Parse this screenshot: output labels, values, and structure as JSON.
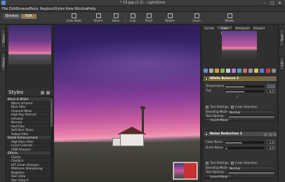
{
  "window": {
    "title": "* 19.jpg (1:2) – LightZone",
    "controls": [
      "–",
      "□",
      "✕"
    ]
  },
  "menu": [
    "File",
    "Edit",
    "Browser",
    "Tools",
    "Regions",
    "Styles",
    "View",
    "Window",
    "Help"
  ],
  "modes": {
    "browse": "Browse",
    "edit": "Edit"
  },
  "toolbar": {
    "items": [
      "Undo Redo",
      "Revert",
      "Done",
      "Crop",
      "Proof",
      "Rotate",
      "Zoom"
    ],
    "right_label": "Modes"
  },
  "left_strip": {
    "tabs": [
      "Styles",
      "History"
    ]
  },
  "styles_panel": {
    "title": "Styles",
    "rows": [
      {
        "label": "Black & White",
        "kind": "cat"
      },
      {
        "label": "Warm Infrared",
        "kind": "item"
      },
      {
        "label": "Blue Filter",
        "kind": "item"
      },
      {
        "label": "Channel Mixer",
        "kind": "item"
      },
      {
        "label": "High Key Portrait",
        "kind": "item"
      },
      {
        "label": "Infrared",
        "kind": "item"
      },
      {
        "label": "Normal",
        "kind": "item"
      },
      {
        "label": "Red Filter",
        "kind": "item"
      },
      {
        "label": "Soft Skin Tones",
        "kind": "item"
      },
      {
        "label": "Yellow Filter",
        "kind": "item"
      },
      {
        "label": "Detail Enhancement",
        "kind": "cat"
      },
      {
        "label": "High-Pass Filter",
        "kind": "item"
      },
      {
        "label": "Local Contrast",
        "kind": "item"
      },
      {
        "label": "USM Sharpen",
        "kind": "item"
      },
      {
        "label": "Effects",
        "kind": "cat"
      },
      {
        "label": "Clarity",
        "kind": "item"
      },
      {
        "label": "Clarity II",
        "kind": "item"
      },
      {
        "label": "HIT Green Sharpen",
        "kind": "item"
      },
      {
        "label": "Midtones Sharpening",
        "kind": "item"
      },
      {
        "label": "Negative",
        "kind": "item"
      },
      {
        "label": "Skin Glow",
        "kind": "item"
      },
      {
        "label": "Skin Glow II",
        "kind": "item"
      },
      {
        "label": "Skin Glow III",
        "kind": "item"
      }
    ]
  },
  "right_panel": {
    "tabs": [
      "Curves",
      "Color Mask",
      "Histogram",
      "Sampler"
    ],
    "active_tab": "Color Mask",
    "tools": [
      {
        "title": "White Balance 1",
        "highlight": true,
        "sliders": [
          {
            "label": "Temperature",
            "value": "5000",
            "fraction": 0.5
          },
          {
            "label": "Tint",
            "value": "0.0",
            "fraction": 0.5
          }
        ],
        "subtabs": [
          "Tool Settings",
          "Color Selection"
        ],
        "blending_label": "Blending Mode:",
        "blending_value": "Normal",
        "opacity_label": "Tool Opacity:",
        "opacity_fraction": 1.0,
        "invert_label": "Invert Mask"
      },
      {
        "title": "Noise Reduction 1",
        "highlight": false,
        "sliders": [
          {
            "label": "Color Noise",
            "value": "2.0",
            "fraction": 0.45
          },
          {
            "label": "Grain Noise",
            "value": "0.0",
            "fraction": 0.05
          }
        ],
        "subtabs": [
          "Tool Settings",
          "Color Selection"
        ],
        "blending_label": "Blending Mode:",
        "blending_value": "Normal",
        "opacity_label": "Tool Opacity:",
        "opacity_fraction": 1.0,
        "invert_label": "Invert Mask"
      }
    ]
  },
  "right_strip": {
    "tabs": [
      "Tools",
      "Info"
    ]
  },
  "colors": {
    "highlight_header": "#7a6a3a",
    "edit_mode": "#8a7a55",
    "nav_red": "#c93030"
  }
}
